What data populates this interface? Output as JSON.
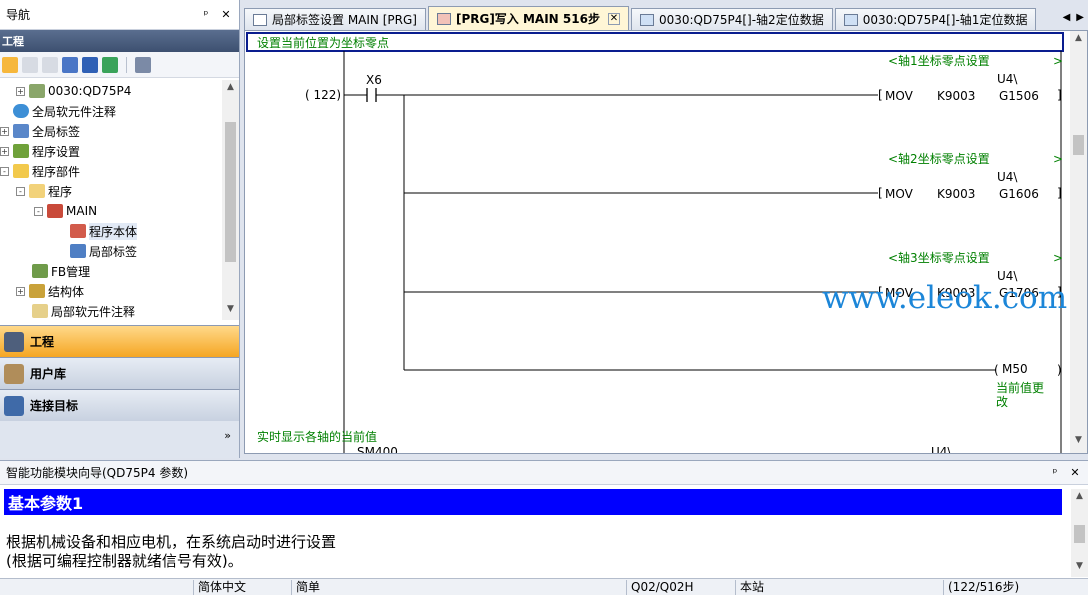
{
  "nav": {
    "title": "导航",
    "pin": "ᵖ",
    "close": "✕",
    "section": "工程",
    "tree": [
      {
        "label": "0030:QD75P4",
        "expander": "+"
      },
      {
        "label": "全局软元件注释",
        "expander": ""
      },
      {
        "label": "全局标签",
        "expander": "+"
      },
      {
        "label": "程序设置",
        "expander": "+"
      },
      {
        "label": "程序部件",
        "expander": "-"
      },
      {
        "label": "程序",
        "expander": "-"
      },
      {
        "label": "MAIN",
        "expander": "-"
      },
      {
        "label": "程序本体",
        "expander": ""
      },
      {
        "label": "局部标签",
        "expander": ""
      },
      {
        "label": "FB管理",
        "expander": ""
      },
      {
        "label": "结构体",
        "expander": "+"
      },
      {
        "label": "局部软元件注释",
        "expander": ""
      }
    ],
    "tabs": {
      "project": "工程",
      "library": "用户库",
      "target": "连接目标"
    },
    "more": "»"
  },
  "doc_tabs": [
    {
      "label": "局部标签设置 MAIN [PRG]",
      "active": false
    },
    {
      "label": "[PRG]写入 MAIN 516步",
      "active": true
    },
    {
      "label": "0030:QD75P4[]-轴2定位数据",
      "active": false
    },
    {
      "label": "0030:QD75P4[]-轴1定位数据",
      "active": false
    }
  ],
  "ladder": {
    "top_comment": "设置当前位置为坐标零点",
    "step": "( 122)",
    "contact": "X6",
    "rungs": [
      {
        "comment": "<轴1坐标零点设置",
        "instr": "MOV",
        "src": "K9003",
        "dst_top": "U4\\",
        "dst": "G1506"
      },
      {
        "comment": "<轴2坐标零点设置",
        "instr": "MOV",
        "src": "K9003",
        "dst_top": "U4\\",
        "dst": "G1606"
      },
      {
        "comment": "<轴3坐标零点设置",
        "instr": "MOV",
        "src": "K9003",
        "dst_top": "U4\\",
        "dst": "G1706"
      }
    ],
    "coil": "M50",
    "coil_comment_1": "当前值更",
    "coil_comment_2": "改",
    "next_comment": "实时显示各轴的当前值",
    "next_contact": "SM400",
    "next_dst": "U4\\"
  },
  "wizard": {
    "title": "智能功能模块向导(QD75P4 参数)",
    "banner": "基本参数1",
    "line1": "根据机械设备和相应电机，在系统启动时进行设置",
    "line2": "(根据可编程控制器就绪信号有效)。"
  },
  "status": {
    "lang": "简体中文",
    "mode": "简单",
    "cpu": "Q02/Q02H",
    "station": "本站",
    "steps": "(122/516步)"
  },
  "watermark": "www.eleok.com"
}
